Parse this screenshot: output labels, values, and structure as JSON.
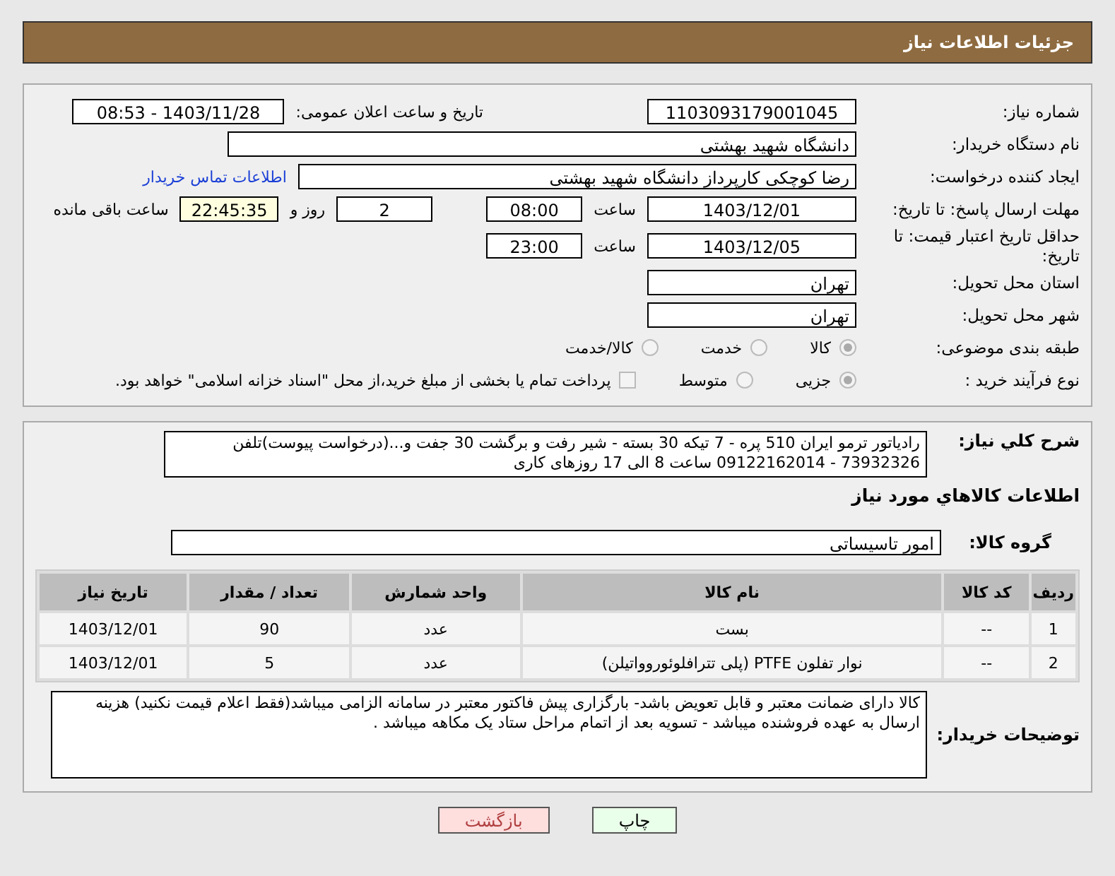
{
  "header": {
    "title": "جزئیات اطلاعات نیاز"
  },
  "need_info": {
    "need_number": {
      "label": "شماره نیاز:",
      "value": "1103093179001045"
    },
    "announce": {
      "label": "تاریخ و ساعت اعلان عمومی:",
      "value": "1403/11/28 - 08:53"
    },
    "buyer_org": {
      "label": "نام دستگاه خریدار:",
      "value": "دانشگاه شهید بهشتی"
    },
    "requester": {
      "label": "ایجاد کننده درخواست:",
      "value": "رضا کوچکی کارپرداز دانشگاه شهید بهشتی",
      "link": "اطلاعات تماس خریدار"
    },
    "deadline": {
      "label": "مهلت ارسال پاسخ: تا تاریخ:",
      "date": "1403/12/01",
      "time_label": "ساعت",
      "time": "08:00",
      "days": "2",
      "days_label": "روز و",
      "remaining": "22:45:35",
      "remaining_label": "ساعت باقی مانده"
    },
    "price_validity": {
      "label": "حداقل تاریخ اعتبار قیمت: تا تاریخ:",
      "date": "1403/12/05",
      "time_label": "ساعت",
      "time": "23:00"
    },
    "province": {
      "label": "استان محل تحویل:",
      "value": "تهران"
    },
    "city": {
      "label": "شهر محل تحویل:",
      "value": "تهران"
    },
    "category": {
      "label": "طبقه بندی موضوعی:",
      "options": [
        {
          "label": "کالا",
          "selected": true
        },
        {
          "label": "خدمت",
          "selected": false
        },
        {
          "label": "کالا/خدمت",
          "selected": false
        }
      ]
    },
    "process": {
      "label": "نوع فرآیند خرید :",
      "options": [
        {
          "label": "جزیی",
          "selected": true
        },
        {
          "label": "متوسط",
          "selected": false
        }
      ],
      "treasury": {
        "label": "پرداخت تمام یا بخشی از مبلغ خرید،از محل \"اسناد خزانه اسلامی\" خواهد بود.",
        "checked": false
      }
    }
  },
  "goods": {
    "description": {
      "label": "شرح کلي نیاز:",
      "value": "رادیاتور ترمو ایران 510 پره - 7 تیکه  30 بسته - شیر رفت و برگشت 30 جفت و...(درخواست پیوست)تلفن 73932326  - 09122162014 ساعت 8 الی 17 روزهای کاری"
    },
    "heading": "اطلاعات کالاهاي مورد نیاز",
    "group": {
      "label": "گروه کالا:",
      "value": "امور تاسیساتی"
    },
    "table": {
      "columns": [
        "ردیف",
        "کد کالا",
        "نام کالا",
        "واحد شمارش",
        "تعداد / مقدار",
        "تاریخ نیاز"
      ],
      "rows": [
        [
          "1",
          "--",
          "بست",
          "عدد",
          "90",
          "1403/12/01"
        ],
        [
          "2",
          "--",
          "نوار تفلون PTFE (پلی تترافلوئوروواتیلن)",
          "عدد",
          "5",
          "1403/12/01"
        ]
      ]
    },
    "buyer_notes": {
      "label": "توضیحات خریدار:",
      "value": "کالا دارای ضمانت معتبر و قابل تعویض باشد- بارگزاری پیش فاکتور معتبر در سامانه الزامی میباشد(فقط اعلام قیمت نکنید) هزینه ارسال به عهده فروشنده میباشد - تسویه بعد از اتمام مراحل ستاد یک مکاهه میباشد ."
    }
  },
  "buttons": [
    {
      "label": "چاپ",
      "kind": "print"
    },
    {
      "label": "بازگشت",
      "kind": "back"
    }
  ]
}
